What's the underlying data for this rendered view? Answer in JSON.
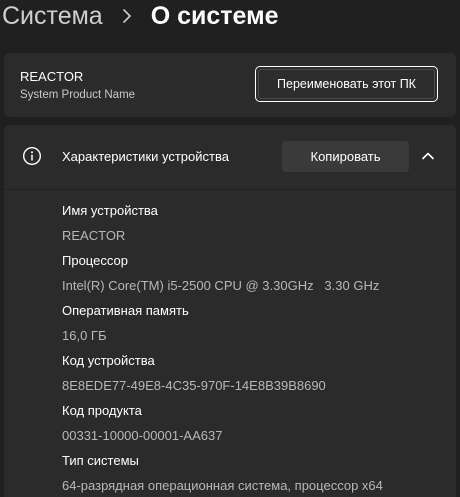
{
  "breadcrumb": {
    "parent": "Система",
    "current": "О системе"
  },
  "rename_card": {
    "pc_name": "REACTOR",
    "product_name": "System Product Name",
    "rename_button": "Переименовать этот ПК"
  },
  "specs": {
    "title": "Характеристики устройства",
    "copy_button": "Копировать",
    "items": [
      {
        "label": "Имя устройства",
        "value": "REACTOR"
      },
      {
        "label": "Процессор",
        "value": "Intel(R) Core(TM) i5-2500 CPU @ 3.30GHz   3.30 GHz"
      },
      {
        "label": "Оперативная память",
        "value": "16,0 ГБ"
      },
      {
        "label": "Код устройства",
        "value": "8E8EDE77-49E8-4C35-970F-14E8B39B8690"
      },
      {
        "label": "Код продукта",
        "value": "00331-10000-00001-AA637"
      },
      {
        "label": "Тип системы",
        "value": "64-разрядная операционная система, процессор x64"
      }
    ]
  },
  "icons": {
    "breadcrumb_separator": "chevron-right-icon",
    "specs_icon": "info-icon",
    "collapse": "chevron-up-icon"
  },
  "colors": {
    "background": "#202020",
    "card": "#2b2b2b",
    "button": "#3a3a3a",
    "text_primary": "#ffffff",
    "text_secondary": "#b8b8b8"
  }
}
